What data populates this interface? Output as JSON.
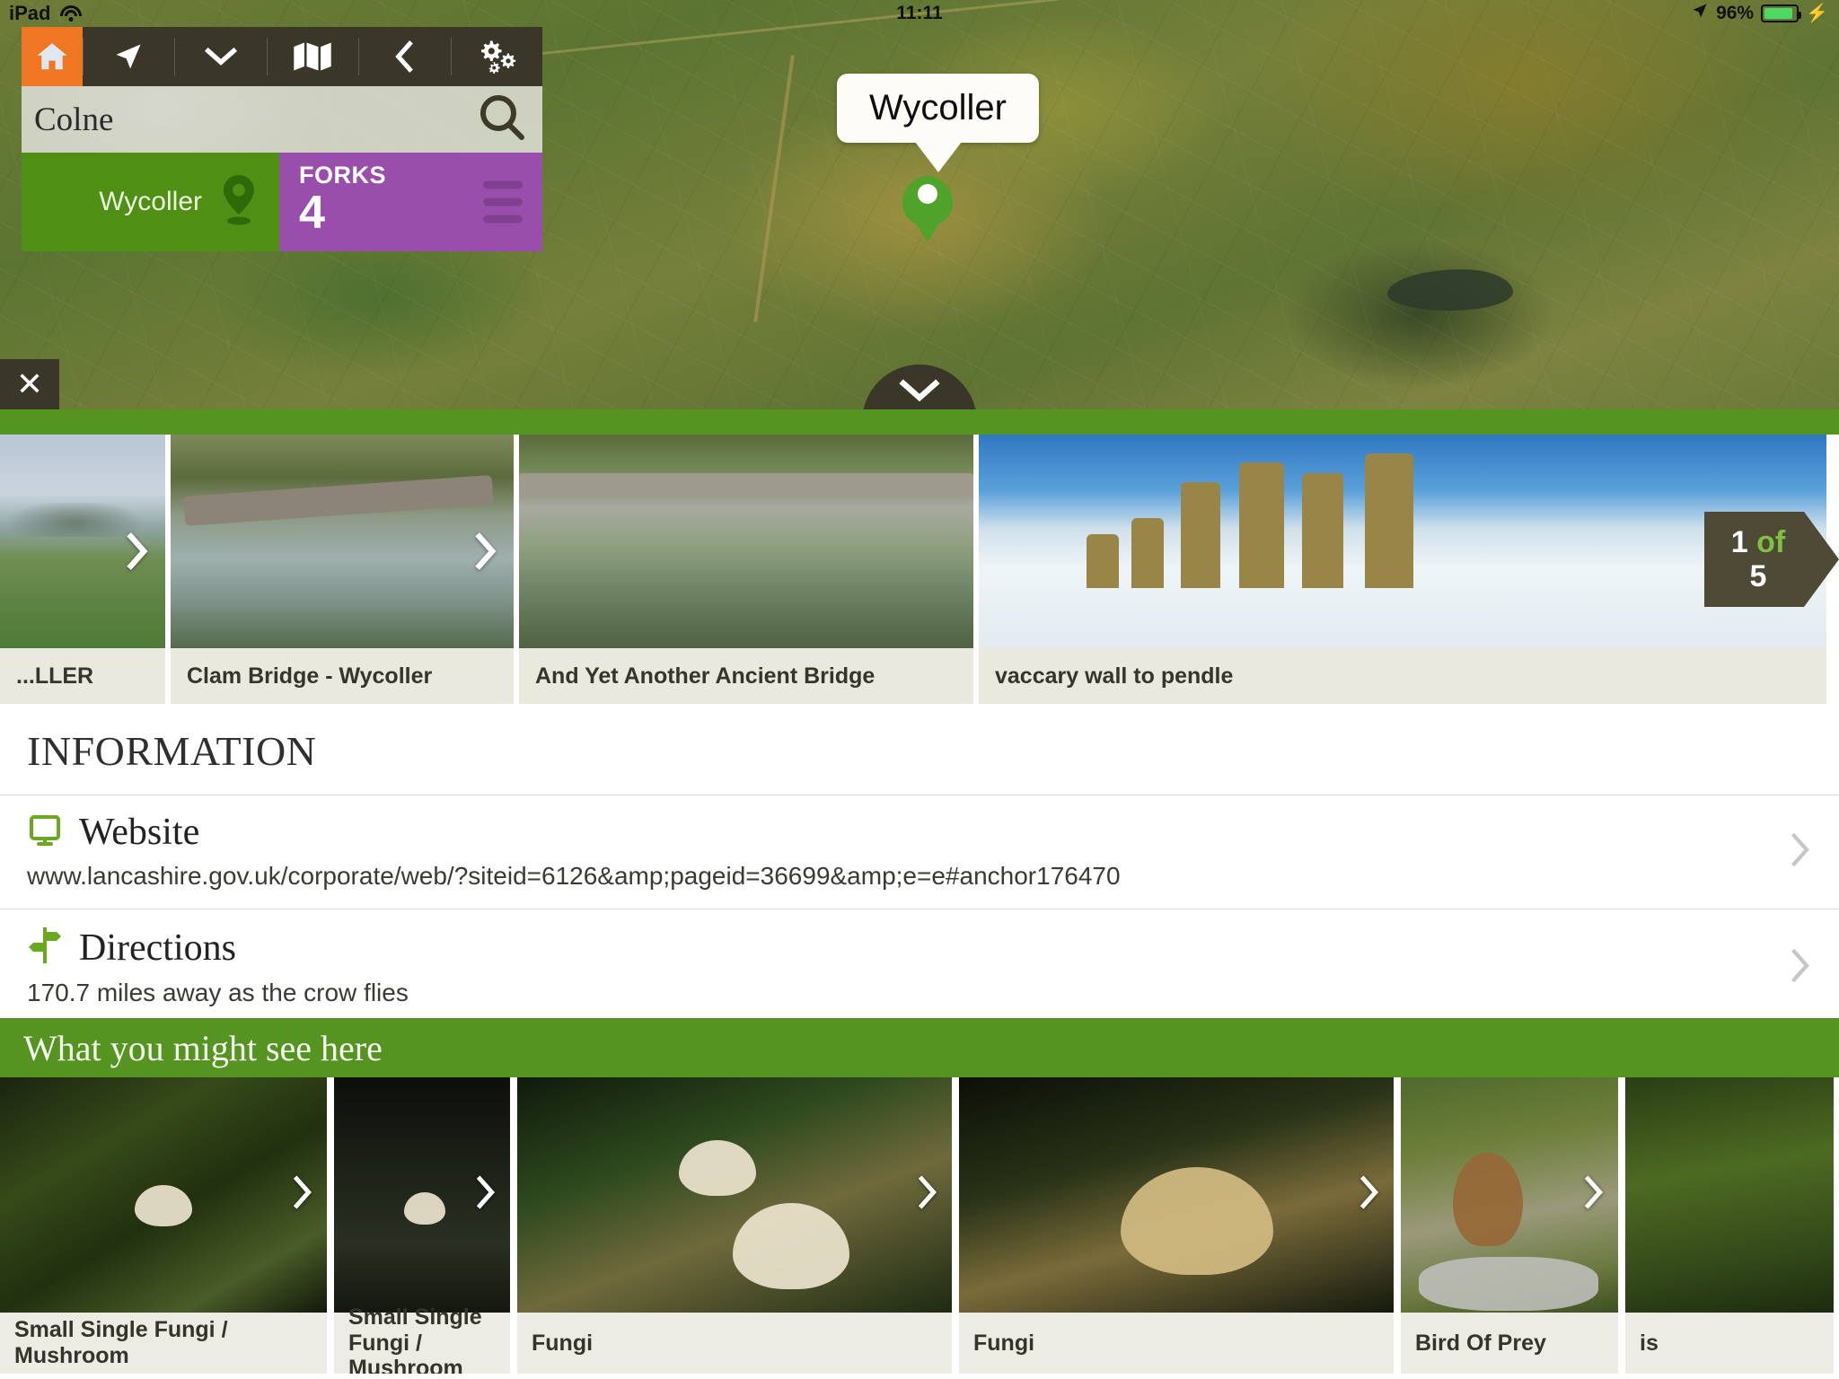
{
  "status_bar": {
    "device": "iPad",
    "wifi_icon": "wifi-icon",
    "time": "11:11",
    "location_icon": "location-arrow-icon",
    "battery_percent": "96%",
    "battery_icon": "battery-icon",
    "charging_icon": "charging-bolt-icon"
  },
  "map": {
    "toolbar": [
      {
        "name": "home-button",
        "icon": "home-icon",
        "active": true
      },
      {
        "name": "locate-button",
        "icon": "navigation-arrow-icon",
        "active": false
      },
      {
        "name": "dropdown-button",
        "icon": "chevron-down-icon",
        "active": false
      },
      {
        "name": "map-layers-button",
        "icon": "map-icon",
        "active": false
      },
      {
        "name": "back-button",
        "icon": "chevron-left-icon",
        "active": false
      },
      {
        "name": "settings-button",
        "icon": "gears-icon",
        "active": false
      }
    ],
    "search": {
      "value": "Colne",
      "placeholder": "Search",
      "icon": "search-icon"
    },
    "place_tile": {
      "label": "Wycoller",
      "icon": "map-pin-icon"
    },
    "forks_tile": {
      "title": "FORKS",
      "count": "4",
      "icon": "list-lines-icon"
    },
    "callout": {
      "label": "Wycoller"
    },
    "close_label": "✕",
    "expand_icon": "chevron-down-icon",
    "accent_colors": {
      "toolbar_bg": "#3a3729",
      "home_orange": "#ef7622",
      "tile_green": "#4e8f14",
      "tile_purple": "#9a4eac",
      "brand_green": "#559420"
    }
  },
  "gallery": {
    "counter": {
      "current": "1",
      "of": "of",
      "total": "5"
    },
    "next_icon": "chevron-right-icon",
    "items": [
      {
        "caption": "...LLER",
        "style": "pendle",
        "partial": true
      },
      {
        "caption": "Clam Bridge - Wycoller",
        "style": "clam",
        "partial": false
      },
      {
        "caption": "And Yet Another Ancient Bridge",
        "style": "bridge",
        "partial": false
      },
      {
        "caption": "vaccary wall to pendle",
        "style": "snow",
        "partial": false
      }
    ]
  },
  "information": {
    "title": "INFORMATION",
    "rows": [
      {
        "label": "Website",
        "icon": "monitor-icon",
        "detail": "www.lancashire.gov.uk/corporate/web/?siteid=6126&amp;pageid=36699&amp;e=e#anchor176470",
        "chevron": "chevron-right-icon"
      },
      {
        "label": "Directions",
        "icon": "signpost-icon",
        "detail": "170.7 miles away as the crow flies",
        "chevron": "chevron-right-icon"
      }
    ]
  },
  "species_section": {
    "header": "What you might see here",
    "next_icon": "chevron-right-icon",
    "items": [
      {
        "caption": "Small Single Fungi / Mushroom",
        "style": "dark1"
      },
      {
        "caption": "Small Single Fungi / Mushroom",
        "style": "dark2"
      },
      {
        "caption": "Fungi",
        "style": "moss"
      },
      {
        "caption": "Fungi",
        "style": "fungi"
      },
      {
        "caption": "Bird Of Prey",
        "style": "kestrel"
      },
      {
        "caption": "is",
        "style": "grass"
      }
    ]
  }
}
